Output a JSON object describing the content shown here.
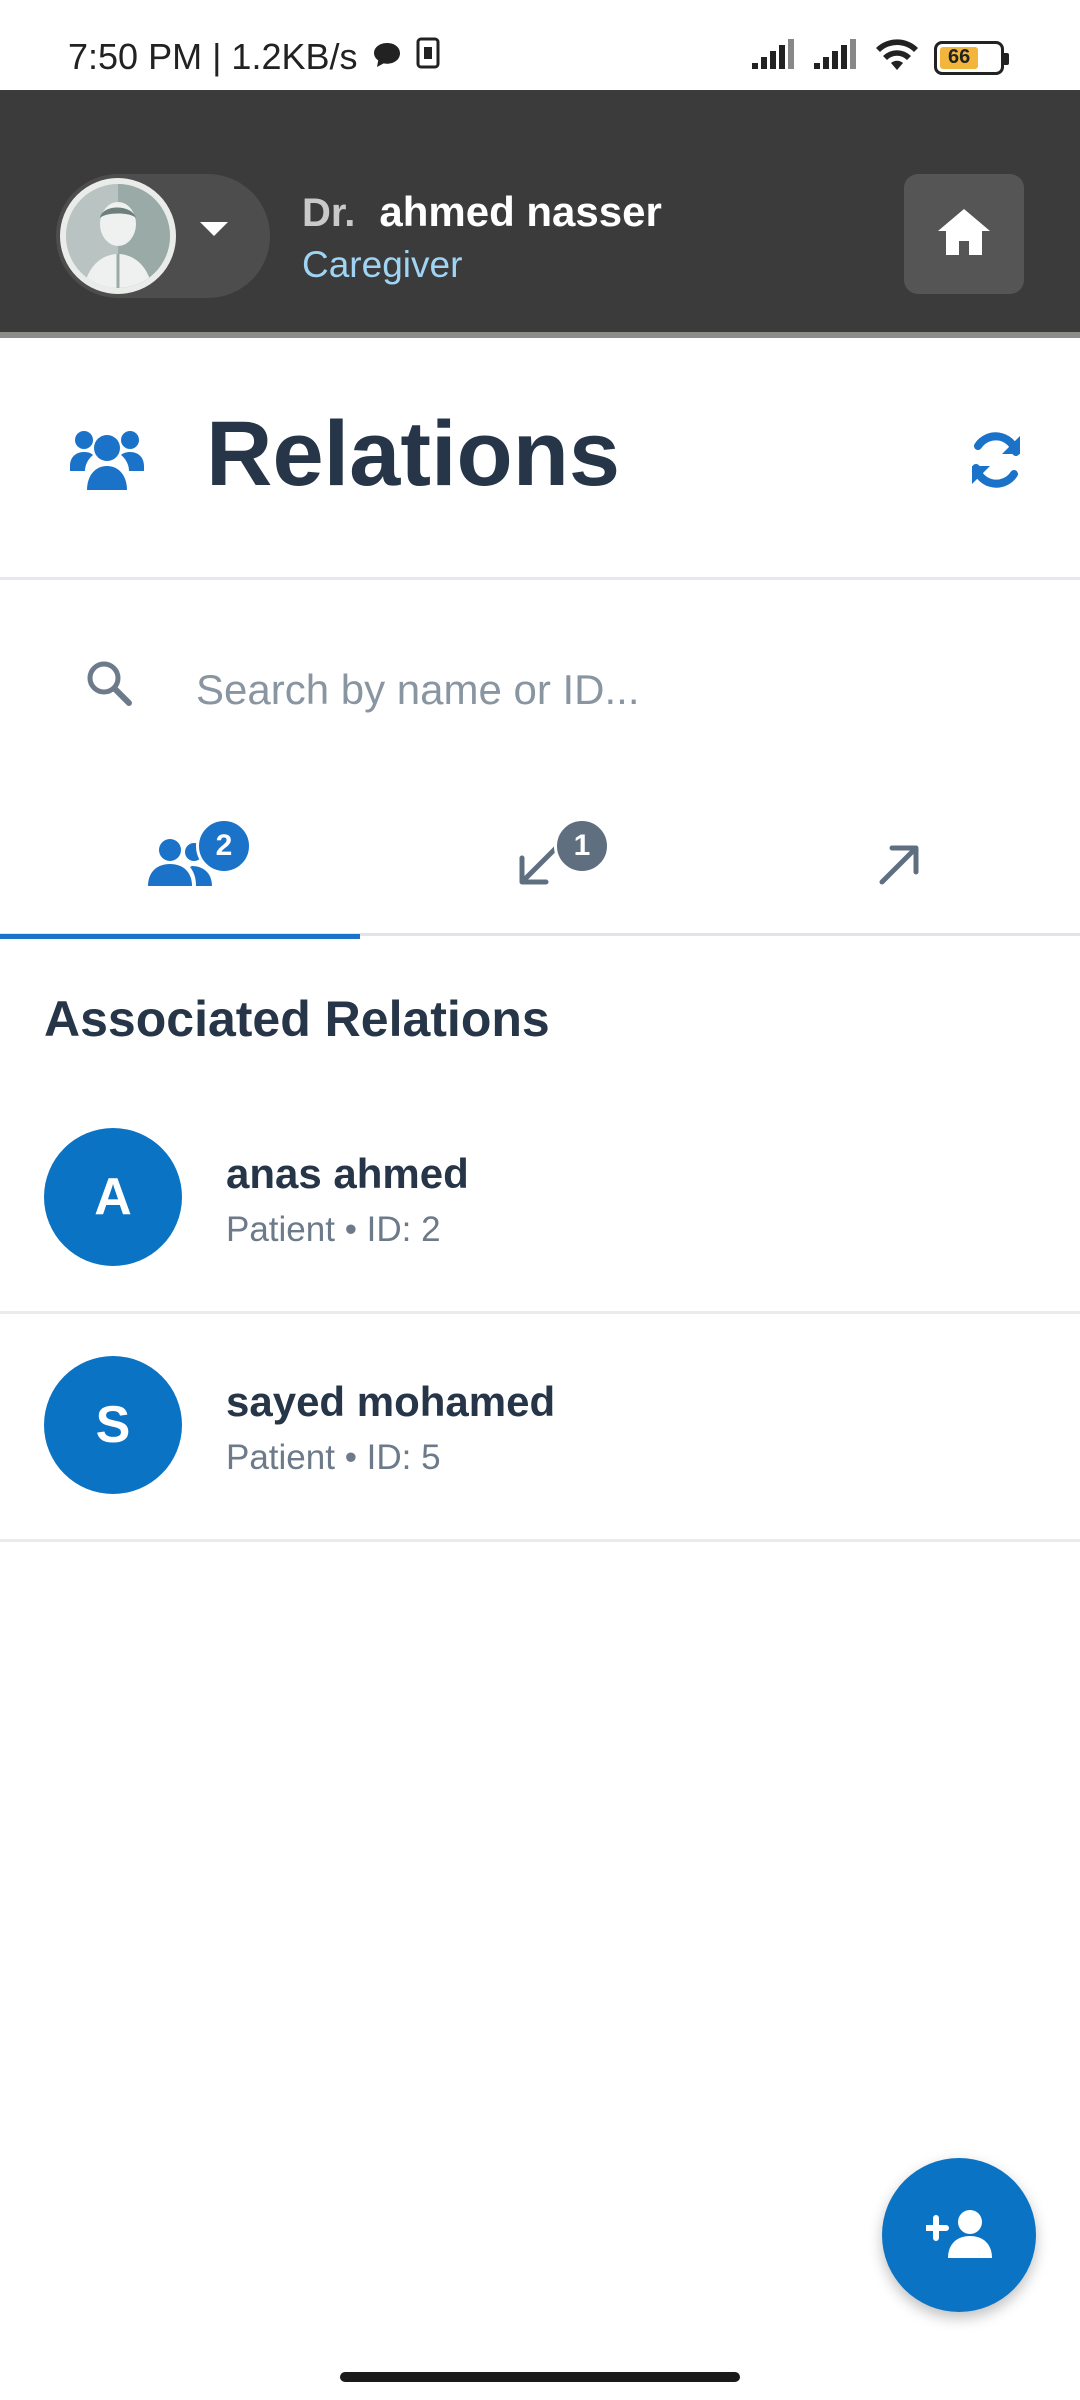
{
  "status_bar": {
    "time_speed": "7:50 PM | 1.2KB/s",
    "battery_level": "66"
  },
  "header": {
    "prefix": "Dr.",
    "name": "ahmed nasser",
    "role": "Caregiver"
  },
  "page": {
    "title": "Relations"
  },
  "search": {
    "placeholder": "Search by name or ID..."
  },
  "tabs": [
    {
      "icon": "users-icon",
      "badge": "2",
      "active": true
    },
    {
      "icon": "arrow-down-left-icon",
      "badge": "1",
      "active": false
    },
    {
      "icon": "arrow-up-right-icon",
      "badge": "",
      "active": false
    }
  ],
  "section": {
    "heading": "Associated Relations"
  },
  "relations": [
    {
      "initial": "A",
      "name": "anas ahmed",
      "meta": "Patient • ID: 2"
    },
    {
      "initial": "S",
      "name": "sayed mohamed",
      "meta": "Patient • ID: 5"
    }
  ],
  "colors": {
    "primary": "#0b73c4",
    "header_bg": "#3b3b3b",
    "text_dark": "#263648"
  }
}
